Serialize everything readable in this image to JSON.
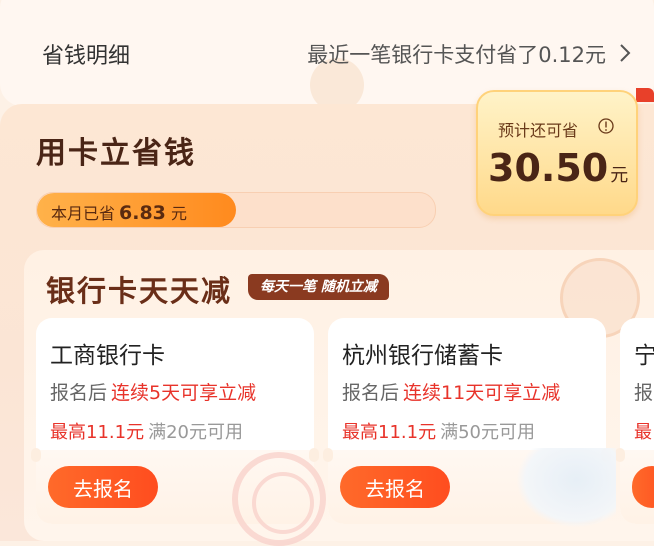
{
  "savings": {
    "title": "省钱明细",
    "detail": "最近一笔银行卡支付省了0.12元"
  },
  "card_savings": {
    "title": "用卡立省钱",
    "month_label": "本月已省",
    "month_value": "6.83",
    "month_unit": "元",
    "progress_fraction": 0.5
  },
  "estimate": {
    "label": "预计还可省",
    "value": "30.50",
    "unit": "元"
  },
  "promo": {
    "title": "银行卡天天减",
    "tag": "每天一笔 随机立减"
  },
  "bank_cards": [
    {
      "name": "工商银行卡",
      "cond_prefix": "报名后",
      "cond_highlight": "连续5天可享立减",
      "limit_highlight": "最高11.1元",
      "limit_rest": "满20元可用",
      "button": "去报名"
    },
    {
      "name": "杭州银行储蓄卡",
      "cond_prefix": "报名后",
      "cond_highlight": "连续11天可享立减",
      "limit_highlight": "最高11.1元",
      "limit_rest": "满50元可用",
      "button": "去报名"
    },
    {
      "name": "宁",
      "cond_prefix": "报",
      "cond_highlight": "",
      "limit_highlight": "最",
      "limit_rest": "",
      "button": ""
    }
  ],
  "icons": {
    "chevron": "chevron-right-icon",
    "info": "info-icon"
  },
  "colors": {
    "accent": "#ff5a22",
    "highlight": "#e8332a",
    "title": "#4a2516"
  }
}
